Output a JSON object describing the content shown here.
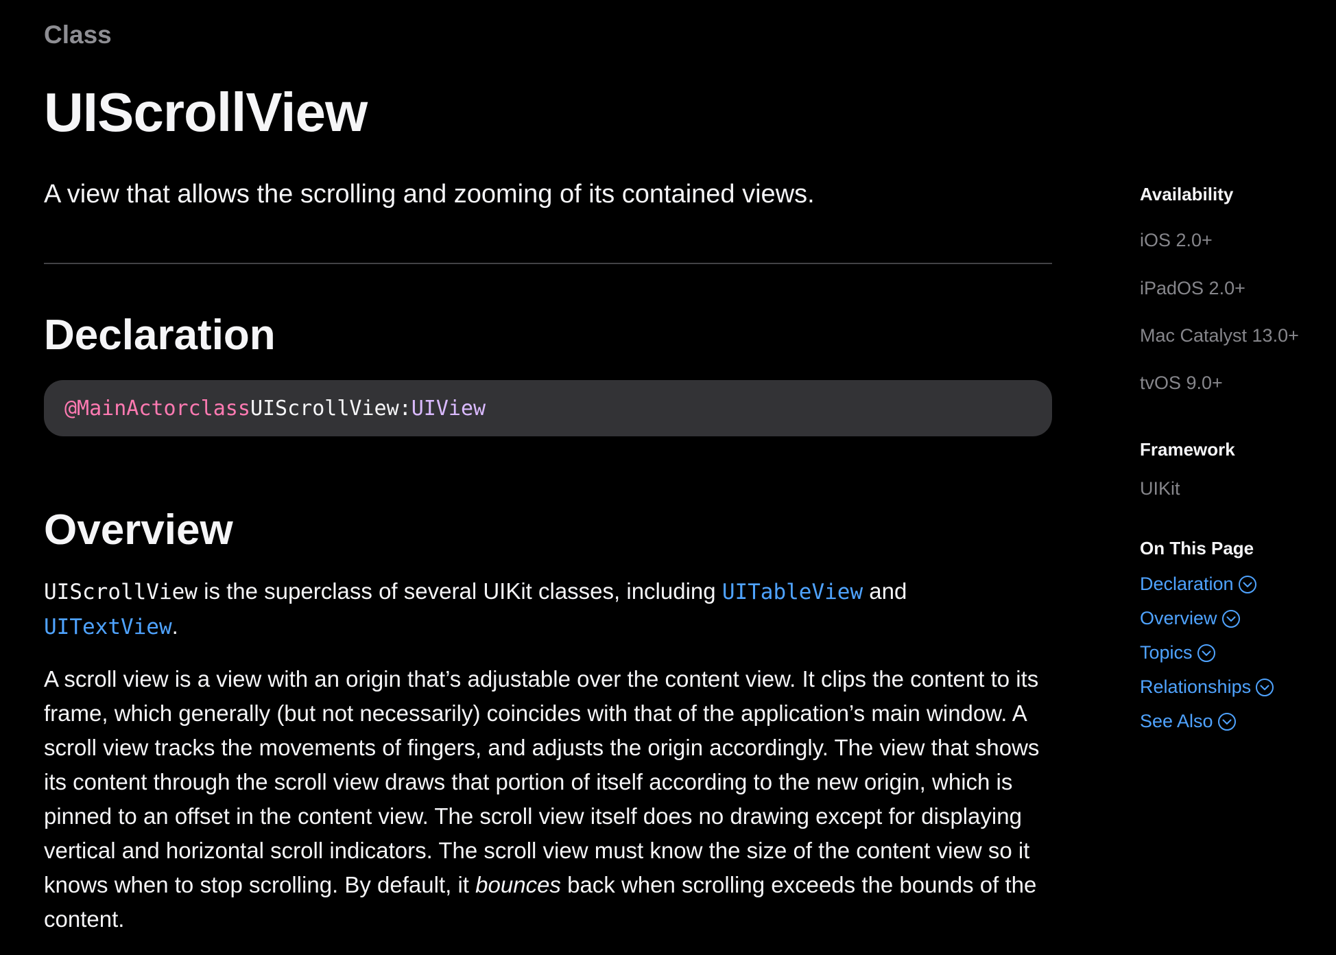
{
  "header": {
    "eyebrow": "Class",
    "title": "UIScrollView",
    "abstract": "A view that allows the scrolling and zooming of its contained views."
  },
  "declaration": {
    "heading": "Declaration",
    "attribute": "@MainActor",
    "keyword": "class",
    "name": "UIScrollView",
    "separator": ":",
    "superclass": "UIView"
  },
  "overview": {
    "heading": "Overview",
    "para1": {
      "code": "UIScrollView",
      "text1": " is the superclass of several UIKit classes, including ",
      "link1": "UITableView",
      "text2": " and ",
      "link2": "UITextView",
      "text3": "."
    },
    "para2": {
      "text1": "A scroll view is a view with an origin that’s adjustable over the content view. It clips the content to its frame, which generally (but not necessarily) coincides with that of the application’s main window. A scroll view tracks the movements of fingers, and adjusts the origin accordingly. The view that shows its content through the scroll view draws that portion of itself according to the new origin, which is pinned to an offset in the content view. The scroll view itself does no drawing except for displaying vertical and horizontal scroll indicators. The scroll view must know the size of the content view so it knows when to stop scrolling. By default, it ",
      "emphasis": "bounces",
      "text2": " back when scrolling exceeds the bounds of the content."
    }
  },
  "sidebar": {
    "availability_heading": "Availability",
    "platforms": [
      "iOS 2.0+",
      "iPadOS 2.0+",
      "Mac Catalyst 13.0+",
      "tvOS 9.0+"
    ],
    "framework_heading": "Framework",
    "framework": "UIKit",
    "on_this_page_heading": "On This Page",
    "on_this_page": [
      "Declaration",
      "Overview",
      "Topics",
      "Relationships",
      "See Also"
    ]
  },
  "colors": {
    "background": "#000000",
    "text": "#f5f5f7",
    "muted": "#86868b",
    "link": "#4fa3ff",
    "code_keyword": "#ff7ab2",
    "code_type": "#dabaff",
    "code_background": "#333336"
  },
  "icons": {
    "on_this_page_link": "chevron-down-circle-icon"
  }
}
